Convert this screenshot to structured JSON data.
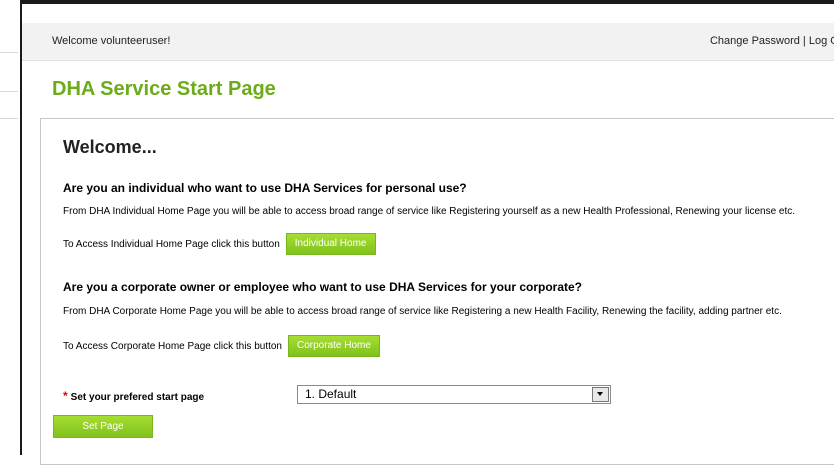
{
  "header": {
    "welcome": "Welcome volunteeruser!",
    "change_password": "Change Password",
    "separator": " | ",
    "logout": "Log Out"
  },
  "page_title": "DHA Service Start Page",
  "content": {
    "welcome_heading": "Welcome...",
    "individual": {
      "question": "Are you an individual who want to use DHA Services for personal use?",
      "description": "From DHA Individual Home Page you will be able to access broad range of service like Registering yourself as a new Health Professional, Renewing your license etc.",
      "access_text": "To Access Individual Home Page click this button",
      "button_label": "Individual Home"
    },
    "corporate": {
      "question": "Are you a corporate owner or employee who want to use DHA Services for your corporate?",
      "description": "From DHA Corporate Home Page you will be able to access broad range of service like Registering a new Health Facility, Renewing the facility, adding partner etc.",
      "access_text": "To Access Corporate Home Page click this button",
      "button_label": "Corporate Home"
    },
    "start_page": {
      "required_mark": "*",
      "label": "Set your prefered start page",
      "selected": "1. Default"
    },
    "set_button": "Set Page"
  },
  "colors": {
    "title_green": "#6cab1a",
    "button_green": "#8fce24",
    "required_red": "#e00000"
  }
}
